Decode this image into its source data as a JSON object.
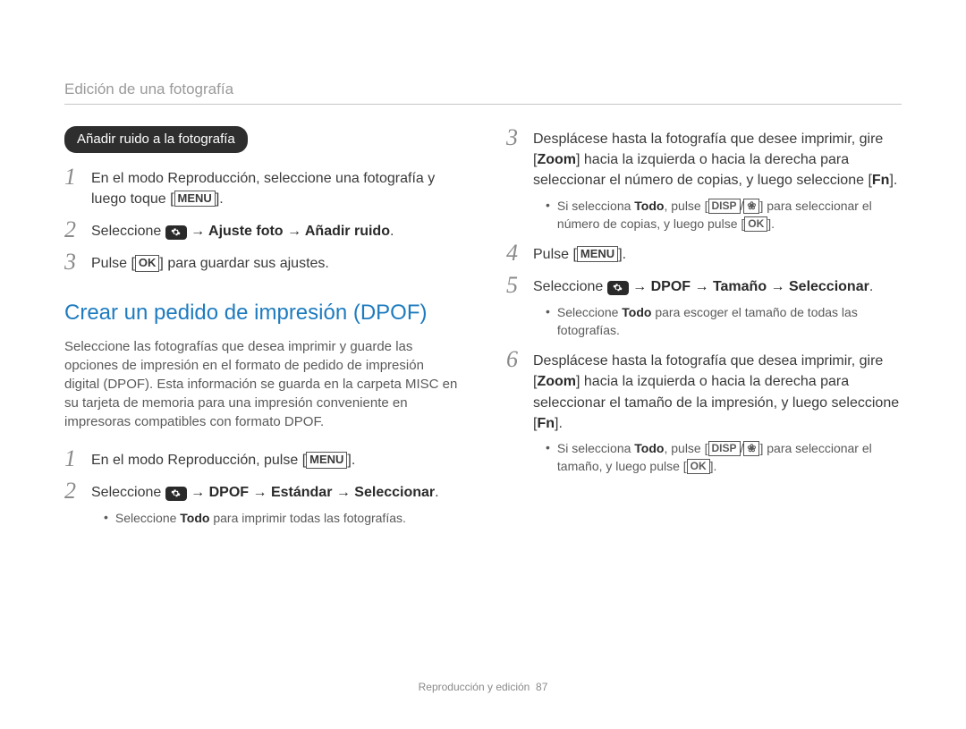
{
  "header": {
    "title": "Edición de una fotografía"
  },
  "pill": {
    "label": "Añadir ruido a la fotografía"
  },
  "keys": {
    "menu": "MENU",
    "ok": "OK",
    "fn": "Fn",
    "zoom": "Zoom",
    "disp": "DISP",
    "macro": "❀"
  },
  "left": {
    "s1": {
      "num": "1",
      "t1": "En el modo Reproducción, seleccione una fotografía y luego toque ["
    },
    "s2": {
      "num": "2",
      "t1": "Seleccione ",
      "path": " → Ajuste foto → Añadir ruido",
      "dot": "."
    },
    "s3": {
      "num": "3",
      "t1": "Pulse [",
      "t2": "] para guardar sus ajustes."
    },
    "h2": "Crear un pedido de impresión (DPOF)",
    "para": "Seleccione las fotografías que desea imprimir y guarde las opciones de impresión en el formato de pedido de impresión digital (DPOF). Esta información se guarda en la carpeta MISC en su tarjeta de memoria para una impresión conveniente en impresoras compatibles con formato DPOF.",
    "s4": {
      "num": "1",
      "t1": "En el modo Reproducción, pulse ["
    },
    "s5": {
      "num": "2",
      "t1": "Seleccione ",
      "path": " → DPOF → Estándar → Seleccionar",
      "dot": "."
    },
    "s5sub": {
      "t1": "Seleccione ",
      "todo": "Todo",
      "t2": " para imprimir todas las fotografías."
    }
  },
  "right": {
    "s3": {
      "num": "3",
      "t1": "Desplácese hasta la fotografía que desee imprimir, gire [",
      "t2": "] hacia la izquierda o hacia la derecha para seleccionar el número de copias, y luego seleccione ["
    },
    "s3sub": {
      "t1": "Si selecciona ",
      "todo": "Todo",
      "t2": ", pulse [",
      "t3": "] para seleccionar el número de copias, y luego pulse ["
    },
    "s4": {
      "num": "4",
      "t1": "Pulse ["
    },
    "s5": {
      "num": "5",
      "t1": "Seleccione ",
      "path": " → DPOF → Tamaño → Seleccionar",
      "dot": "."
    },
    "s5sub": {
      "t1": "Seleccione ",
      "todo": "Todo",
      "t2": " para escoger el tamaño de todas las fotografías."
    },
    "s6": {
      "num": "6",
      "t1": "Desplácese hasta la fotografía que desea imprimir, gire [",
      "t2": "] hacia la izquierda o hacia la derecha para seleccionar el tamaño de la impresión, y luego seleccione ["
    },
    "s6sub": {
      "t1": "Si selecciona ",
      "todo": "Todo",
      "t2": ", pulse [",
      "t3": "] para seleccionar el tamaño, y luego pulse ["
    }
  },
  "footer": {
    "section": "Reproducción y edición",
    "page": "87"
  }
}
